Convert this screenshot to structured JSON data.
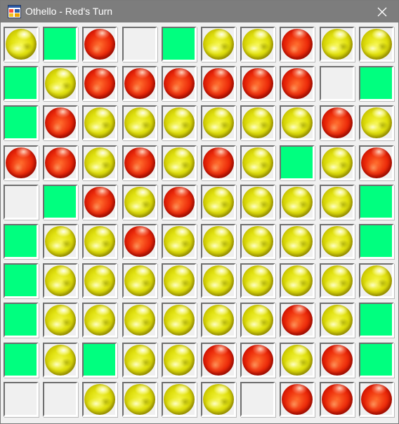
{
  "window": {
    "title": "Othello - Red's Turn",
    "icon": "form-icon",
    "close_icon": "close-icon"
  },
  "board": {
    "rows": 10,
    "cols": 10,
    "legend": {
      "R": "red-disc",
      "Y": "yellow-disc",
      "V": "valid-move-highlight",
      "E": "empty"
    },
    "cells": [
      [
        "Y",
        "V",
        "R",
        "E",
        "V",
        "Y",
        "Y",
        "R",
        "Y",
        "Y"
      ],
      [
        "V",
        "Y",
        "R",
        "R",
        "R",
        "R",
        "R",
        "R",
        "E",
        "V"
      ],
      [
        "V",
        "R",
        "Y",
        "Y",
        "Y",
        "Y",
        "Y",
        "Y",
        "R",
        "Y"
      ],
      [
        "R",
        "R",
        "Y",
        "R",
        "Y",
        "R",
        "Y",
        "V",
        "Y",
        "R"
      ],
      [
        "E",
        "V",
        "R",
        "Y",
        "R",
        "Y",
        "Y",
        "Y",
        "Y",
        "V"
      ],
      [
        "V",
        "Y",
        "Y",
        "R",
        "Y",
        "Y",
        "Y",
        "Y",
        "Y",
        "V"
      ],
      [
        "V",
        "Y",
        "Y",
        "Y",
        "Y",
        "Y",
        "Y",
        "Y",
        "Y",
        "Y"
      ],
      [
        "V",
        "Y",
        "Y",
        "Y",
        "Y",
        "Y",
        "Y",
        "R",
        "Y",
        "V"
      ],
      [
        "V",
        "Y",
        "V",
        "Y",
        "Y",
        "R",
        "R",
        "Y",
        "R",
        "V"
      ],
      [
        "E",
        "E",
        "Y",
        "Y",
        "Y",
        "Y",
        "E",
        "R",
        "R",
        "R"
      ]
    ]
  },
  "colors": {
    "red_disc": "#e8280a",
    "yellow_disc": "#e0e00e",
    "valid_move": "#00ff7f",
    "empty_cell": "#f0f0f0",
    "titlebar": "#7d7d7d"
  }
}
